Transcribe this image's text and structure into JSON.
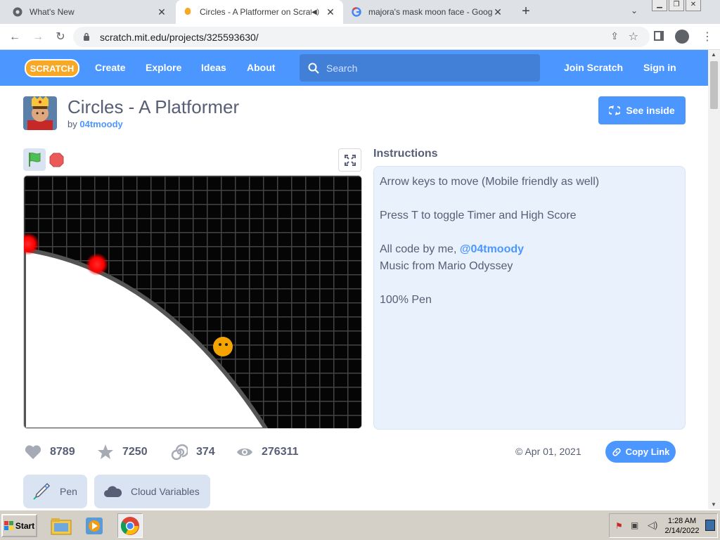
{
  "browser": {
    "tabs": [
      {
        "title": "What's New",
        "active": false
      },
      {
        "title": "Circles - A Platformer on Scratch",
        "active": true
      },
      {
        "title": "majora's mask moon face - Google Search",
        "active": false
      }
    ],
    "url": "scratch.mit.edu/projects/325593630/"
  },
  "nav": {
    "logo_text": "SCRATCH",
    "links": [
      "Create",
      "Explore",
      "Ideas",
      "About"
    ],
    "search_placeholder": "Search",
    "join": "Join Scratch",
    "signin": "Sign in"
  },
  "project": {
    "title": "Circles - A Platformer",
    "by_prefix": "by",
    "author": "04tmoody",
    "see_inside": "See inside"
  },
  "instructions": {
    "heading": "Instructions",
    "lines": [
      "Arrow keys to move (Mobile friendly as well)",
      "",
      "Press T to toggle Timer and High Score",
      "",
      "All code by me,",
      "Music from Mario Odyssey",
      "",
      "100% Pen"
    ],
    "mention": "@04tmoody"
  },
  "stats": {
    "loves": "8789",
    "favorites": "7250",
    "remixes": "374",
    "views": "276311",
    "date": "Apr 01, 2021",
    "copy_link": "Copy Link"
  },
  "tags": [
    "Pen",
    "Cloud Variables"
  ],
  "taskbar": {
    "start": "Start",
    "time": "1:28 AM",
    "date": "2/14/2022"
  },
  "colors": {
    "scratch_blue": "#4c97ff",
    "text": "#575e75",
    "instr_bg": "#e9f1fc"
  }
}
